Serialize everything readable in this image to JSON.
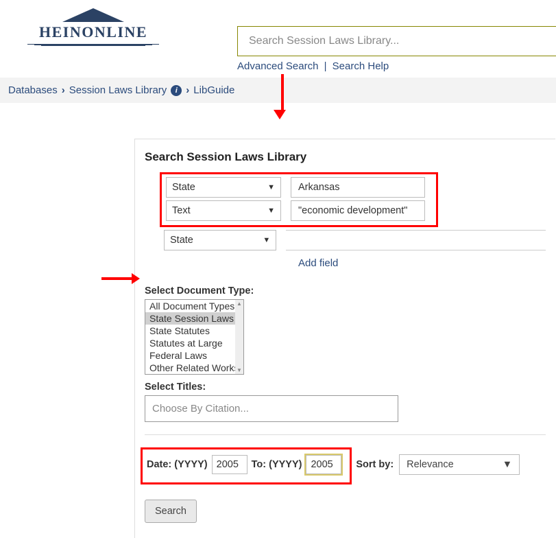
{
  "logo": {
    "text": "HEINONLINE"
  },
  "top_search": {
    "placeholder": "Search Session Laws Library...",
    "advanced": "Advanced Search",
    "help": "Search Help",
    "sep": "|"
  },
  "breadcrumb": {
    "databases": "Databases",
    "library": "Session Laws Library",
    "libguide": "LibGuide"
  },
  "panel": {
    "title": "Search Session Laws Library",
    "fields": [
      {
        "type": "State",
        "value": "Arkansas"
      },
      {
        "type": "Text",
        "value": "\"economic development\""
      },
      {
        "type": "State",
        "value": ""
      }
    ],
    "add_field": "Add field",
    "doc_type": {
      "label": "Select Document Type:",
      "items": [
        "All Document Types",
        "State Session Laws",
        "State Statutes",
        "Statutes at Large",
        "Federal Laws",
        "Other Related Works"
      ],
      "selected_index": 1
    },
    "titles": {
      "label": "Select Titles:",
      "placeholder": "Choose By Citation..."
    },
    "date": {
      "from_label": "Date: (YYYY)",
      "to_label": "To: (YYYY)",
      "from": "2005",
      "to": "2005"
    },
    "sort": {
      "label": "Sort by:",
      "value": "Relevance"
    },
    "search_button": "Search"
  }
}
